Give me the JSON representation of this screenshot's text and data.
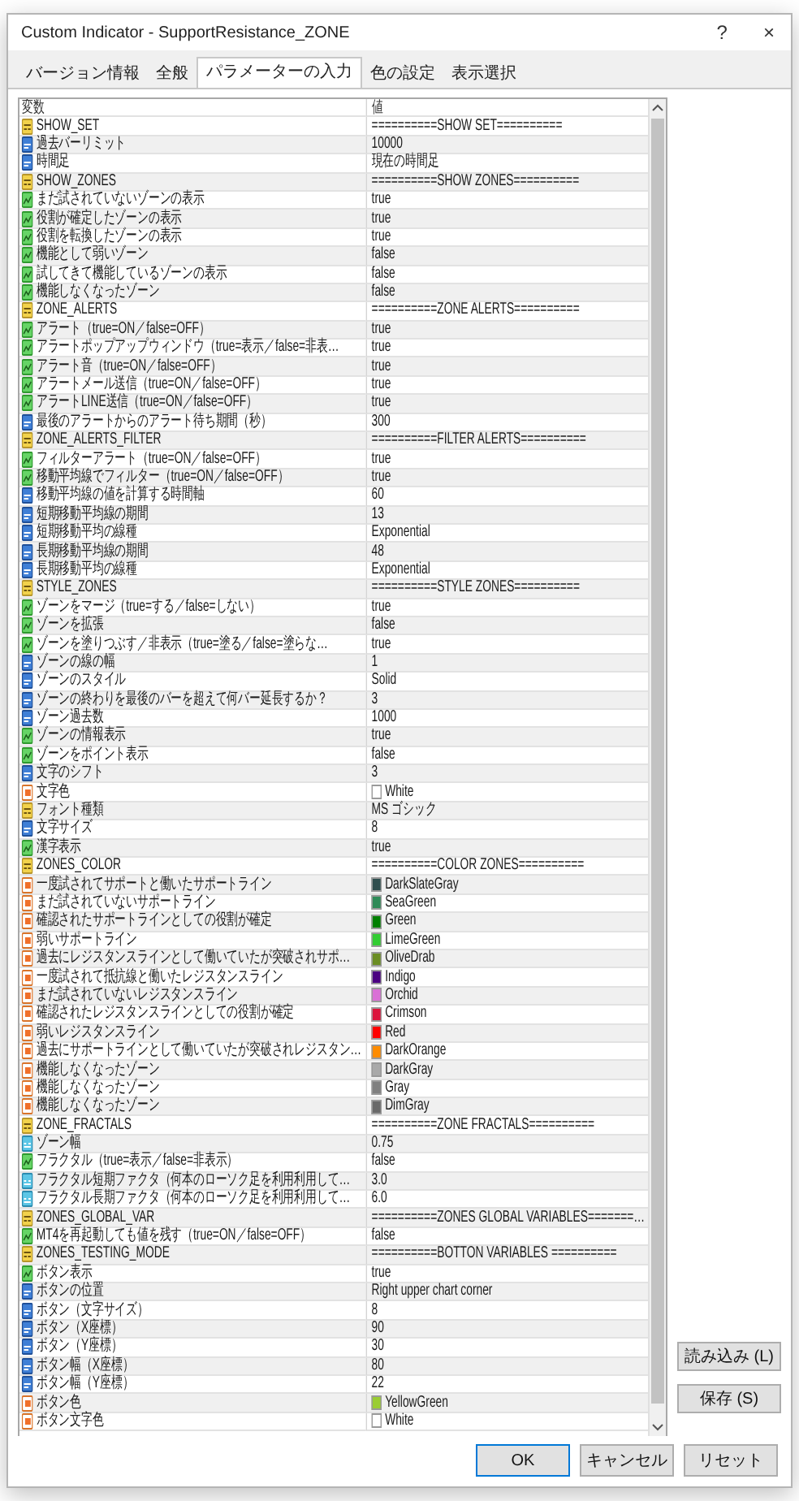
{
  "window": {
    "title": "Custom Indicator - SupportResistance_ZONE",
    "help_button": "?",
    "close_button": "×"
  },
  "tabs": [
    {
      "label": "バージョン情報",
      "selected": false
    },
    {
      "label": "全般",
      "selected": false
    },
    {
      "label": "パラメーターの入力",
      "selected": true
    },
    {
      "label": "色の設定",
      "selected": false
    },
    {
      "label": "表示選択",
      "selected": false
    }
  ],
  "table": {
    "columns": [
      "変数",
      "値"
    ],
    "rows": [
      {
        "kind": "string",
        "name": "SHOW_SET",
        "value": "==========SHOW SET=========="
      },
      {
        "kind": "int",
        "name": "過去バーリミット",
        "value": "10000"
      },
      {
        "kind": "int",
        "name": "時間足",
        "value": "現在の時間足"
      },
      {
        "kind": "string",
        "name": "SHOW_ZONES",
        "value": "==========SHOW ZONES=========="
      },
      {
        "kind": "bool",
        "name": "まだ試されていないゾーンの表示",
        "value": "true"
      },
      {
        "kind": "bool",
        "name": "役割が確定したゾーンの表示",
        "value": "true"
      },
      {
        "kind": "bool",
        "name": "役割を転換したゾーンの表示",
        "value": "true"
      },
      {
        "kind": "bool",
        "name": "機能として弱いゾーン",
        "value": "false"
      },
      {
        "kind": "bool",
        "name": "試してきて機能しているゾーンの表示",
        "value": "false"
      },
      {
        "kind": "bool",
        "name": "機能しなくなったゾーン",
        "value": "false"
      },
      {
        "kind": "string",
        "name": "ZONE_ALERTS",
        "value": "==========ZONE ALERTS=========="
      },
      {
        "kind": "bool",
        "name": "アラート（true=ON／false=OFF）",
        "value": "true"
      },
      {
        "kind": "bool",
        "name": "アラートポップアップウィンドウ（true=表示／false=非表…",
        "value": "true"
      },
      {
        "kind": "bool",
        "name": "アラート音（true=ON／false=OFF）",
        "value": "true"
      },
      {
        "kind": "bool",
        "name": "アラートメール送信（true=ON／false=OFF）",
        "value": "true"
      },
      {
        "kind": "bool",
        "name": "アラートLINE送信（true=ON／false=OFF）",
        "value": "true"
      },
      {
        "kind": "int",
        "name": "最後のアラートからのアラート待ち期間（秒）",
        "value": "300"
      },
      {
        "kind": "string",
        "name": "ZONE_ALERTS_FILTER",
        "value": "==========FILTER ALERTS=========="
      },
      {
        "kind": "bool",
        "name": "フィルターアラート（true=ON／false=OFF）",
        "value": "true"
      },
      {
        "kind": "bool",
        "name": "移動平均線でフィルター（true=ON／false=OFF）",
        "value": "true"
      },
      {
        "kind": "int",
        "name": "移動平均線の値を計算する時間軸",
        "value": "60"
      },
      {
        "kind": "int",
        "name": "短期移動平均線の期間",
        "value": "13"
      },
      {
        "kind": "int",
        "name": "短期移動平均の線種",
        "value": "Exponential"
      },
      {
        "kind": "int",
        "name": "長期移動平均線の期間",
        "value": "48"
      },
      {
        "kind": "int",
        "name": "長期移動平均の線種",
        "value": "Exponential"
      },
      {
        "kind": "string",
        "name": "STYLE_ZONES",
        "value": "==========STYLE ZONES=========="
      },
      {
        "kind": "bool",
        "name": "ゾーンをマージ（true=する／false=しない）",
        "value": "true"
      },
      {
        "kind": "bool",
        "name": "ゾーンを拡張",
        "value": "false"
      },
      {
        "kind": "bool",
        "name": "ゾーンを塗りつぶす／非表示（true=塗る／false=塗らな…",
        "value": "true"
      },
      {
        "kind": "int",
        "name": "ゾーンの線の幅",
        "value": "1"
      },
      {
        "kind": "int",
        "name": "ゾーンのスタイル",
        "value": "Solid"
      },
      {
        "kind": "int",
        "name": "ゾーンの終わりを最後のバーを超えて何バー延長するか？",
        "value": "3"
      },
      {
        "kind": "int",
        "name": "ゾーン過去数",
        "value": "1000"
      },
      {
        "kind": "bool",
        "name": "ゾーンの情報表示",
        "value": "true"
      },
      {
        "kind": "bool",
        "name": "ゾーンをポイント表示",
        "value": "false"
      },
      {
        "kind": "int",
        "name": "文字のシフト",
        "value": "3"
      },
      {
        "kind": "color",
        "name": "文字色",
        "value": "White",
        "color": "#ffffff"
      },
      {
        "kind": "string",
        "name": "フォント種類",
        "value": "MS ゴシック"
      },
      {
        "kind": "int",
        "name": "文字サイズ",
        "value": "8"
      },
      {
        "kind": "bool",
        "name": "漢字表示",
        "value": "true"
      },
      {
        "kind": "string",
        "name": "ZONES_COLOR",
        "value": "==========COLOR ZONES=========="
      },
      {
        "kind": "color",
        "name": "一度試されてサポートと働いたサポートライン",
        "value": "DarkSlateGray",
        "color": "#2f4f4f"
      },
      {
        "kind": "color",
        "name": "まだ試されていないサポートライン",
        "value": "SeaGreen",
        "color": "#2e8b57"
      },
      {
        "kind": "color",
        "name": "確認されたサポートラインとしての役割が確定",
        "value": "Green",
        "color": "#008000"
      },
      {
        "kind": "color",
        "name": "弱いサポートライン",
        "value": "LimeGreen",
        "color": "#32cd32"
      },
      {
        "kind": "color",
        "name": "過去にレジスタンスラインとして働いていたが突破されサポ…",
        "value": "OliveDrab",
        "color": "#6b8e23"
      },
      {
        "kind": "color",
        "name": "一度試されて抵抗線と働いたレジスタンスライン",
        "value": "Indigo",
        "color": "#4b0082"
      },
      {
        "kind": "color",
        "name": "まだ試されていないレジスタンスライン",
        "value": "Orchid",
        "color": "#da70d6"
      },
      {
        "kind": "color",
        "name": "確認されたレジスタンスラインとしての役割が確定",
        "value": "Crimson",
        "color": "#dc143c"
      },
      {
        "kind": "color",
        "name": "弱いレジスタンスライン",
        "value": "Red",
        "color": "#ff0000"
      },
      {
        "kind": "color",
        "name": "過去にサポートラインとして働いていたが突破されレジスタン…",
        "value": "DarkOrange",
        "color": "#ff8c00"
      },
      {
        "kind": "color",
        "name": "機能しなくなったゾーン",
        "value": "DarkGray",
        "color": "#a9a9a9"
      },
      {
        "kind": "color",
        "name": "機能しなくなったゾーン",
        "value": "Gray",
        "color": "#808080"
      },
      {
        "kind": "color",
        "name": "機能しなくなったゾーン",
        "value": "DimGray",
        "color": "#696969"
      },
      {
        "kind": "string",
        "name": "ZONE_FRACTALS",
        "value": "==========ZONE FRACTALS=========="
      },
      {
        "kind": "double",
        "name": "ゾーン幅",
        "value": "0.75"
      },
      {
        "kind": "bool",
        "name": "フラクタル（true=表示／false=非表示）",
        "value": "false"
      },
      {
        "kind": "double",
        "name": "フラクタル短期ファクタ（何本のローソク足を利用利用して…",
        "value": "3.0"
      },
      {
        "kind": "double",
        "name": "フラクタル長期ファクタ（何本のローソク足を利用利用して…",
        "value": "6.0"
      },
      {
        "kind": "string",
        "name": "ZONES_GLOBAL_VAR",
        "value": "==========ZONES GLOBAL VARIABLES=======…"
      },
      {
        "kind": "bool",
        "name": "MT4を再起動しても値を残す（true=ON／false=OFF）",
        "value": "false"
      },
      {
        "kind": "string",
        "name": "ZONES_TESTING_MODE",
        "value": "==========BOTTON VARIABLES =========="
      },
      {
        "kind": "bool",
        "name": "ボタン表示",
        "value": "true"
      },
      {
        "kind": "int",
        "name": "ボタンの位置",
        "value": "Right upper chart corner"
      },
      {
        "kind": "int",
        "name": "ボタン（文字サイズ）",
        "value": "8"
      },
      {
        "kind": "int",
        "name": "ボタン（X座標）",
        "value": "90"
      },
      {
        "kind": "int",
        "name": "ボタン（Y座標）",
        "value": "30"
      },
      {
        "kind": "int",
        "name": "ボタン幅（X座標）",
        "value": "80"
      },
      {
        "kind": "int",
        "name": "ボタン幅（Y座標）",
        "value": "22"
      },
      {
        "kind": "color",
        "name": "ボタン色",
        "value": "YellowGreen",
        "color": "#9acd32"
      },
      {
        "kind": "color",
        "name": "ボタン文字色",
        "value": "White",
        "color": "#ffffff"
      }
    ]
  },
  "side_buttons": [
    "読み込み (L)",
    "保存 (S)"
  ],
  "buttons": [
    {
      "label": "OK",
      "default": true
    },
    {
      "label": "キャンセル",
      "default": false
    },
    {
      "label": "リセット",
      "default": false
    }
  ]
}
